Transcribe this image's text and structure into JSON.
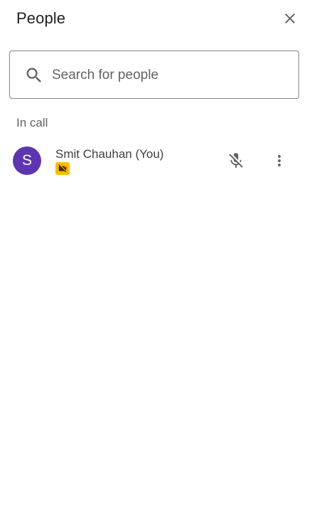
{
  "header": {
    "title": "People",
    "close_icon": "close-icon"
  },
  "search": {
    "placeholder": "Search for people",
    "value": "",
    "icon": "search-icon"
  },
  "sections": [
    {
      "label": "In call",
      "participants": [
        {
          "initial": "S",
          "name": "Smit Chauhan (You)",
          "avatar_color": "#5e35b1",
          "camera_status": "camera-off",
          "camera_badge_color": "#fbbc04",
          "mic_status": "muted",
          "mic_icon": "mic-off-icon",
          "more_icon": "more-vert-icon"
        }
      ]
    }
  ]
}
